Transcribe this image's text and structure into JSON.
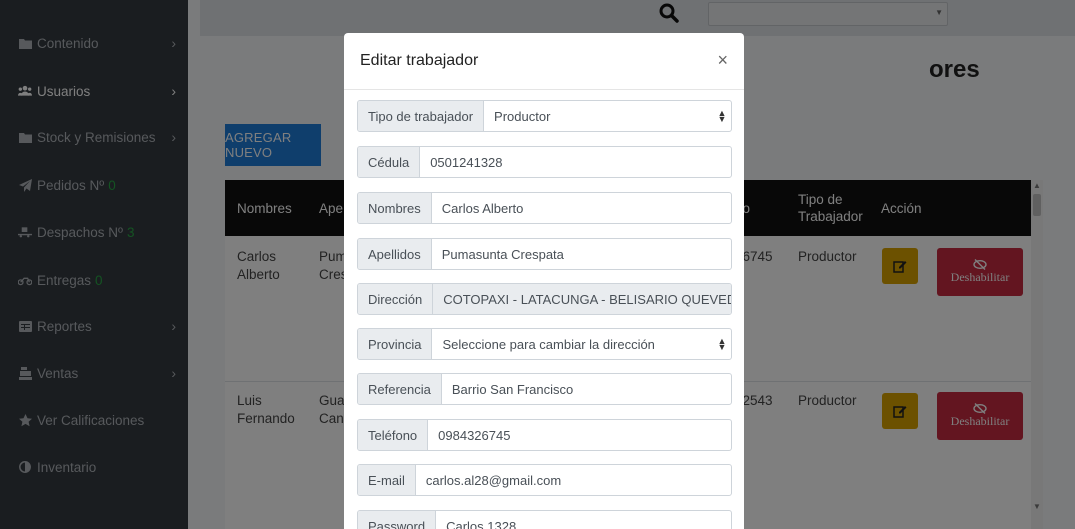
{
  "sidebar": {
    "items": [
      {
        "label": "Contenido",
        "icon": "folder-icon",
        "chevron": true,
        "count": ""
      },
      {
        "label": "Usuarios",
        "icon": "users-icon",
        "chevron": true,
        "count": "",
        "active": true
      },
      {
        "label": "Stock y Remisiones",
        "icon": "folder-icon",
        "chevron": true,
        "count": ""
      },
      {
        "label": "Pedidos Nº",
        "icon": "paper-plane-icon",
        "chevron": false,
        "count": "0"
      },
      {
        "label": "Despachos Nº",
        "icon": "truck-loading-icon",
        "chevron": false,
        "count": "3"
      },
      {
        "label": "Entregas",
        "icon": "motorcycle-icon",
        "chevron": false,
        "count": "0"
      },
      {
        "label": "Reportes",
        "icon": "table-icon",
        "chevron": true,
        "count": ""
      },
      {
        "label": "Ventas",
        "icon": "cash-register-icon",
        "chevron": true,
        "count": ""
      },
      {
        "label": "Ver Calificaciones",
        "icon": "star-icon",
        "chevron": false,
        "count": ""
      },
      {
        "label": "Inventario",
        "icon": "adjust-icon",
        "chevron": false,
        "count": ""
      }
    ]
  },
  "page": {
    "title_fragment": "ores",
    "add_button": "AGREGAR NUEVO"
  },
  "table": {
    "headers": [
      "Nombres",
      "Ape",
      "no",
      "Tipo de Trabajador",
      "Acción"
    ],
    "rows": [
      {
        "nombres": "Carlos Alberto",
        "apellidos": "Pum Cres",
        "telefono": "26745",
        "tipo": "Productor"
      },
      {
        "nombres": "Luis Fernando",
        "apellidos": "Gua Cano",
        "telefono": "72543",
        "tipo": "Productor"
      }
    ],
    "disable_label": "Deshabilitar"
  },
  "modal": {
    "title": "Editar trabajador",
    "close": "×",
    "fields": [
      {
        "label": "Tipo de trabajador",
        "value": "Productor",
        "type": "select"
      },
      {
        "label": "Cédula",
        "value": "0501241328",
        "type": "text"
      },
      {
        "label": "Nombres",
        "value": "Carlos Alberto",
        "type": "text"
      },
      {
        "label": "Apellidos",
        "value": "Pumasunta Crespata",
        "type": "text"
      },
      {
        "label": "Dirección",
        "value": "COTOPAXI - LATACUNGA - BELISARIO QUEVEDO (",
        "type": "readonly"
      },
      {
        "label": "Provincia",
        "value": "Seleccione para cambiar la dirección",
        "type": "select"
      },
      {
        "label": "Referencia",
        "value": "Barrio San Francisco",
        "type": "text"
      },
      {
        "label": "Teléfono",
        "value": "0984326745",
        "type": "text"
      },
      {
        "label": "E-mail",
        "value": "carlos.al28@gmail.com",
        "type": "text"
      },
      {
        "label": "Password",
        "value": "Carlos.1328",
        "type": "text"
      }
    ]
  },
  "colors": {
    "sidebar_bg": "#343a40",
    "primary": "#1e7cd8",
    "warning": "#d9a300",
    "danger": "#c62a40",
    "success_count": "#28a745"
  }
}
